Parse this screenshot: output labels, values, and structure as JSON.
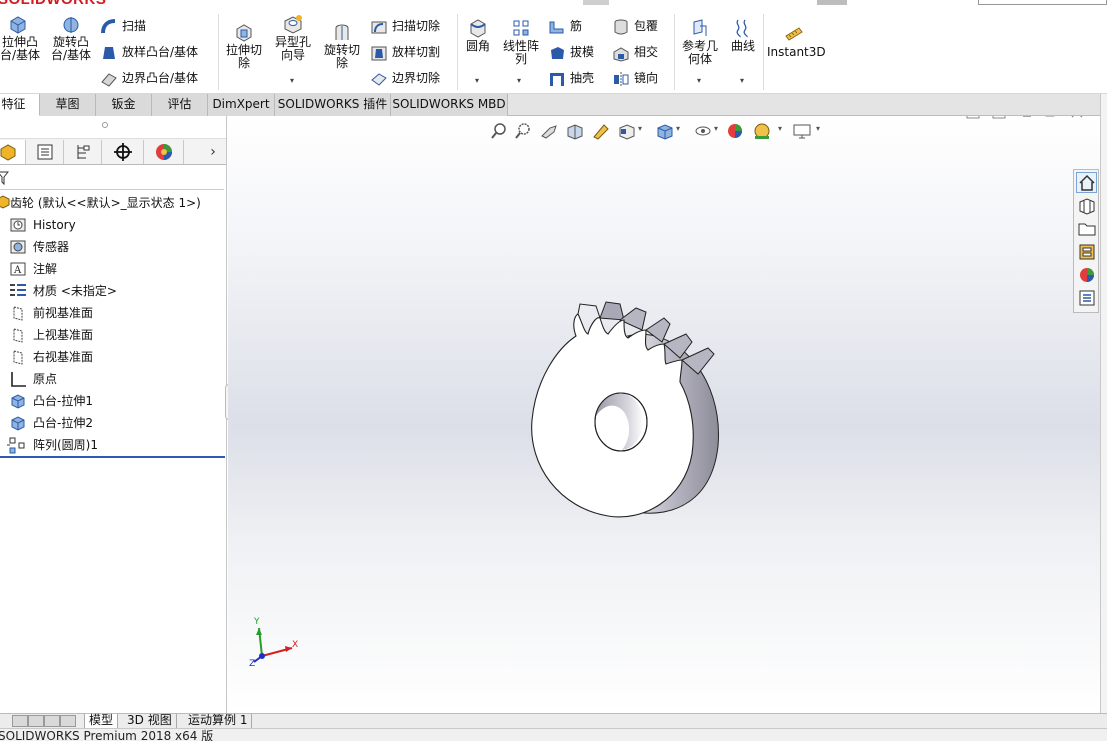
{
  "app": {
    "logo_text": "SOLIDWORKS",
    "status_text": "SOLIDWORKS Premium 2018 x64 版"
  },
  "ribbon": {
    "extrude_boss": "拉伸凸台/基体",
    "revolve_boss": "旋转凸台/基体",
    "sweep": "扫描",
    "loft_boss": "放样凸台/基体",
    "boundary_boss": "边界凸台/基体",
    "extrude_cut": "拉伸切除",
    "hole_wizard": "异型孔向导",
    "revolve_cut": "旋转切除",
    "swept_cut": "扫描切除",
    "lofted_cut": "放样切割",
    "boundary_cut": "边界切除",
    "fillet": "圆角",
    "linear_pattern": "线性阵列",
    "rib": "筋",
    "draft": "拔模",
    "shell": "抽壳",
    "wrap": "包覆",
    "intersect": "相交",
    "mirror": "镜向",
    "ref_geometry": "参考几何体",
    "curves": "曲线",
    "instant3d": "Instant3D"
  },
  "tabs": [
    "特征",
    "草图",
    "钣金",
    "评估",
    "DimXpert",
    "SOLIDWORKS 插件",
    "SOLIDWORKS MBD"
  ],
  "tree": {
    "root": "齿轮 (默认<<默认>_显示状态 1>)",
    "items": [
      "History",
      "传感器",
      "注解",
      "材质 <未指定>",
      "前视基准面",
      "上视基准面",
      "右视基准面",
      "原点",
      "凸台-拉伸1",
      "凸台-拉伸2",
      "阵列(圆周)1"
    ]
  },
  "triad": {
    "x": "X",
    "y": "Y",
    "z": "Z"
  },
  "bottom_tabs": [
    "模型",
    "3D 视图",
    "运动算例 1"
  ],
  "icons": {
    "feature_manager": "feature-manager-icon",
    "property_manager": "property-manager-icon",
    "config_manager": "configuration-manager-icon",
    "dimxpert_manager": "dimxpert-manager-icon",
    "display_manager": "display-manager-icon"
  }
}
